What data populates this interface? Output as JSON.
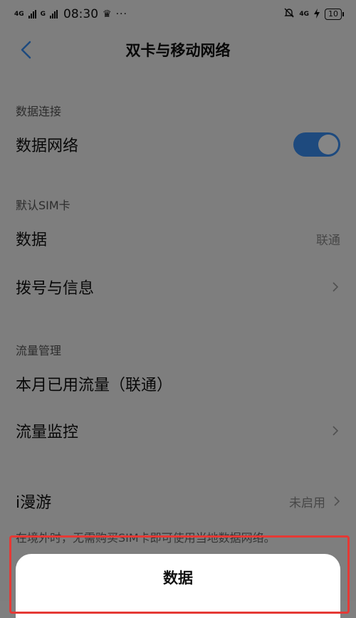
{
  "status_bar": {
    "net1": "4G",
    "net2": "G",
    "time": "08:30",
    "dots": "···",
    "net3": "4G",
    "battery": "10"
  },
  "header": {
    "title": "双卡与移动网络"
  },
  "sections": {
    "data_connection": "数据连接",
    "default_sim": "默认SIM卡",
    "traffic": "流量管理"
  },
  "rows": {
    "data_network": {
      "label": "数据网络",
      "toggle_on": true
    },
    "data": {
      "label": "数据",
      "value": "联通"
    },
    "dial_sms": {
      "label": "拨号与信息"
    },
    "month_usage": {
      "label": "本月已用流量（联通）"
    },
    "traffic_monitor": {
      "label": "流量监控"
    },
    "roaming": {
      "label": "i漫游",
      "value": "未启用"
    }
  },
  "footnote": "在境外时，无需购买SIM卡即可使用当地数据网络。",
  "sheet": {
    "title": "数据"
  },
  "colors": {
    "accent": "#3a8ef2",
    "highlight": "#e53935"
  }
}
